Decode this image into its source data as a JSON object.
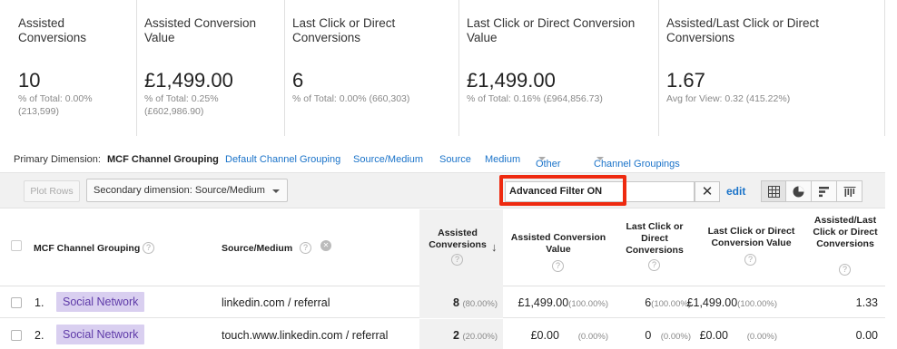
{
  "summary": [
    {
      "title": "Assisted Conversions",
      "value": "10",
      "sub": "% of Total: 0.00% (213,599)"
    },
    {
      "title": "Assisted Conversion Value",
      "value": "£1,499.00",
      "sub": "% of Total: 0.25% (£602,986.90)"
    },
    {
      "title": "Last Click or Direct Conversions",
      "value": "6",
      "sub": "% of Total: 0.00% (660,303)"
    },
    {
      "title": "Last Click or Direct Conversion Value",
      "value": "£1,499.00",
      "sub": "% of Total: 0.16% (£964,856.73)"
    },
    {
      "title": "Assisted/Last Click or Direct Conversions",
      "value": "1.67",
      "sub": "Avg for View: 0.32 (415.22%)"
    }
  ],
  "primary_dimension": {
    "label": "Primary Dimension:",
    "active": "MCF Channel Grouping",
    "links": [
      "Default Channel Grouping",
      "Source/Medium",
      "Source",
      "Medium",
      "Other",
      "Channel Groupings"
    ]
  },
  "toolbar": {
    "plot_rows": "Plot Rows",
    "secondary_dimension": "Secondary dimension: Source/Medium",
    "filter_text": "Advanced Filter ON",
    "clear": "✕",
    "edit": "edit"
  },
  "table": {
    "headers": {
      "channel": "MCF Channel Grouping",
      "source": "Source/Medium",
      "assisted_conv": "Assisted Conversions",
      "assisted_value": "Assisted Conversion Value",
      "last_click_conv": "Last Click or Direct Conversions",
      "last_click_value": "Last Click or Direct Conversion Value",
      "ratio": "Assisted/Last Click or Direct Conversions"
    },
    "sort_arrow": "↓",
    "help": "?",
    "remove": "✕",
    "rows": [
      {
        "index": "1.",
        "channel": "Social Network",
        "source": "linkedin.com / referral",
        "assisted_conv": "8",
        "assisted_conv_pct": "(80.00%)",
        "assisted_value": "£1,499.00",
        "assisted_value_pct": "(100.00%)",
        "last_click_conv": "6",
        "last_click_conv_pct": "(100.00%)",
        "last_click_value": "£1,499.00",
        "last_click_value_pct": "(100.00%)",
        "ratio": "1.33"
      },
      {
        "index": "2.",
        "channel": "Social Network",
        "source": "touch.www.linkedin.com / referral",
        "assisted_conv": "2",
        "assisted_conv_pct": "(20.00%)",
        "assisted_value": "£0.00",
        "assisted_value_pct": "(0.00%)",
        "last_click_conv": "0",
        "last_click_conv_pct": "(0.00%)",
        "last_click_value": "£0.00",
        "last_click_value_pct": "(0.00%)",
        "ratio": "0.00"
      }
    ]
  },
  "colors": {
    "link": "#1a73c9",
    "chip_bg": "#d9cff0",
    "chip_text": "#5e3aa8",
    "highlight": "#ee2a10"
  },
  "icons": [
    "table-view-icon",
    "pie-view-icon",
    "performance-view-icon",
    "comparison-view-icon",
    "help-icon",
    "close-icon",
    "sort-desc-icon"
  ]
}
